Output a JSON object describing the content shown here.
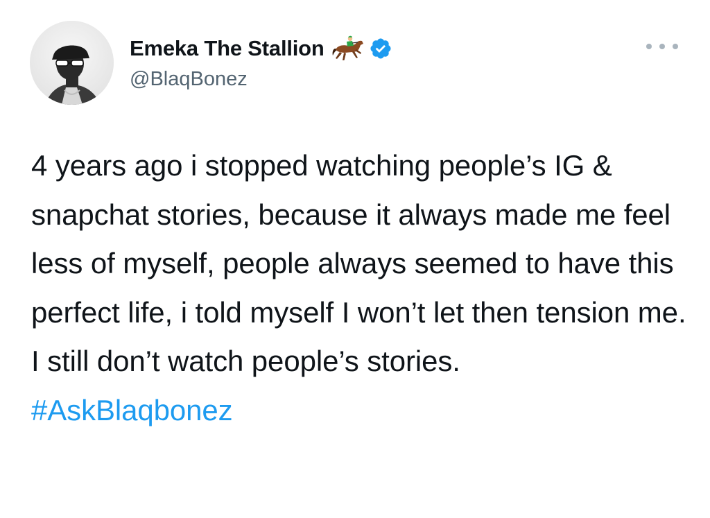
{
  "author": {
    "display_name": "Emeka The Stallion",
    "handle": "@BlaqBonez",
    "name_emoji": "horse-racing-icon",
    "verified": true,
    "avatar": "profile-photo"
  },
  "tweet": {
    "body": "4 years ago i stopped watching people’s IG & snapchat stories, because it always made me feel less of myself, people always seemed to have this perfect life, i told myself I won’t let then tension me. I still don’t watch people’s stories.",
    "hashtag": "#AskBlaqbonez"
  },
  "menu": {
    "icon": "more-horizontal-icon"
  },
  "colors": {
    "text": "#0f1419",
    "secondary": "#536471",
    "accent": "#1d9bf0",
    "verified": "#1d9bf0"
  }
}
